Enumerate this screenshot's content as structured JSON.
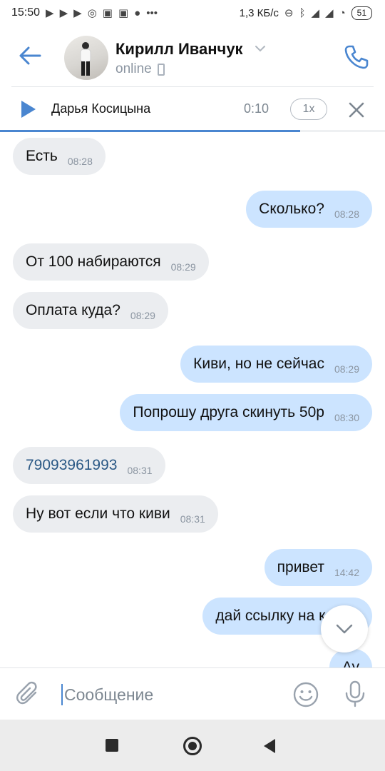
{
  "status_bar": {
    "time": "15:50",
    "speed": "1,3 КБ/с",
    "battery": "51",
    "icons": [
      "play-store-icon",
      "play-store-icon",
      "play-store-icon",
      "search-icon",
      "youtube-icon",
      "youtube-icon",
      "chat-icon",
      "more-icon",
      "alarm-toggle-icon",
      "bluetooth-icon",
      "signal-icon",
      "signal-icon",
      "wifi-icon"
    ]
  },
  "header": {
    "title": "Кирилл Иванчук",
    "status": "online"
  },
  "player": {
    "track": "Дарья Косицына",
    "time": "0:10",
    "speed": "1x",
    "progress": 0.78
  },
  "messages": [
    {
      "dir": "in",
      "text": "Есть",
      "time": "08:28"
    },
    {
      "dir": "out",
      "text": "Сколько?",
      "time": "08:28"
    },
    {
      "dir": "in",
      "text": "От 100 набираются",
      "time": "08:29"
    },
    {
      "dir": "in",
      "text": "Оплата куда?",
      "time": "08:29"
    },
    {
      "dir": "out",
      "text": "Киви, но не сейчас",
      "time": "08:29"
    },
    {
      "dir": "out",
      "text": "Попрошу друга скинуть 50р",
      "time": "08:30"
    },
    {
      "dir": "in",
      "text": "79093961993",
      "time": "08:31",
      "link": true
    },
    {
      "dir": "in",
      "text": "Ну вот если что киви",
      "time": "08:31"
    },
    {
      "dir": "out",
      "text": "привет",
      "time": "14:42"
    },
    {
      "dir": "out",
      "text": "дай ссылку на канал",
      "time": ""
    },
    {
      "dir": "out",
      "text": "Ау",
      "time": ""
    }
  ],
  "composer": {
    "placeholder": "Сообщение"
  },
  "colors": {
    "accent": "#4a86d0",
    "incoming": "#ebedf0",
    "outgoing": "#cce4ff",
    "link": "#2a5885"
  }
}
